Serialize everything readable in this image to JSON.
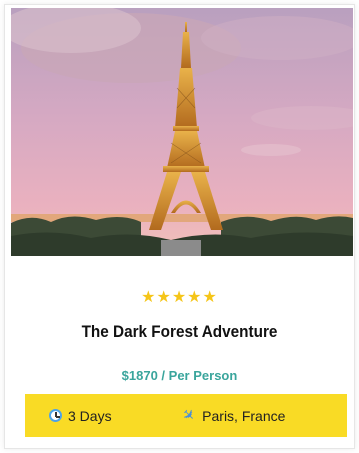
{
  "card": {
    "image_alt_icon": "eiffel-tower-photo",
    "rating": {
      "stars": [
        "★",
        "★",
        "★",
        "★",
        "★"
      ],
      "value": 5,
      "max": 5,
      "color": "#f5c518"
    },
    "title": "The Dark Forest Adventure",
    "price": "$1870 / Per Person",
    "duration": "3 Days",
    "location": "Paris, France",
    "colors": {
      "accent": "#3aa59c",
      "bar": "#f9db25"
    }
  }
}
